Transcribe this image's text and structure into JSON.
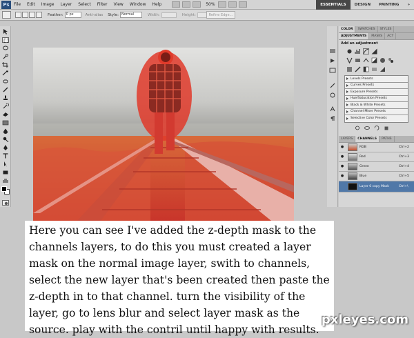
{
  "app": {
    "logo": "Ps"
  },
  "menubar": {
    "items": [
      "File",
      "Edit",
      "Image",
      "Layer",
      "Select",
      "Filter",
      "View",
      "Window",
      "Help"
    ],
    "zoom": "50%"
  },
  "workspaces": [
    "ESSENTIALS",
    "DESIGN",
    "PAINTING",
    "»"
  ],
  "options": {
    "feather_label": "Feather:",
    "feather_value": "0 px",
    "antialias_label": "Anti-alias",
    "style_label": "Style:",
    "style_value": "Normal",
    "width_label": "Width:",
    "height_label": "Height:",
    "refine_label": "Refine Edge..."
  },
  "panels": {
    "top_tabs": [
      "COLOR",
      "SWATCHES",
      "STYLES"
    ],
    "adj_tabs": [
      "ADJUSTMENTS",
      "MASKS",
      "ACT"
    ],
    "adj_title": "Add an adjustment",
    "presets": [
      "Levels Presets",
      "Curves Presets",
      "Exposure Presets",
      "Hue/Saturation Presets",
      "Black & White Presets",
      "Channel Mixer Presets",
      "Selective Color Presets"
    ],
    "layer_tabs": [
      "LAYERS",
      "CHANNELS",
      "PATHS"
    ],
    "channels": [
      {
        "name": "RGB",
        "key": "Ctrl+2"
      },
      {
        "name": "Red",
        "key": "Ctrl+3"
      },
      {
        "name": "Green",
        "key": "Ctrl+4"
      },
      {
        "name": "Blue",
        "key": "Ctrl+5"
      },
      {
        "name": "Layer 0 copy Mask",
        "key": "Ctrl+\\"
      }
    ]
  },
  "caption": {
    "text": "Here you can see I've added the z-depth mask to the channels layers, to do this you must created a layer mask on the normal image layer, swith to channels, select the new layer that's been created then paste the z-depth in to that channel. turn the visibility of the layer, go to lens blur and select layer mask as the source. play with the contril until happy with results."
  },
  "watermark": "pxleyes.com",
  "colors": {
    "mask_overlay": "#e03a2a",
    "selected_channel": "#5078a8",
    "workspace_active": "#474747"
  }
}
